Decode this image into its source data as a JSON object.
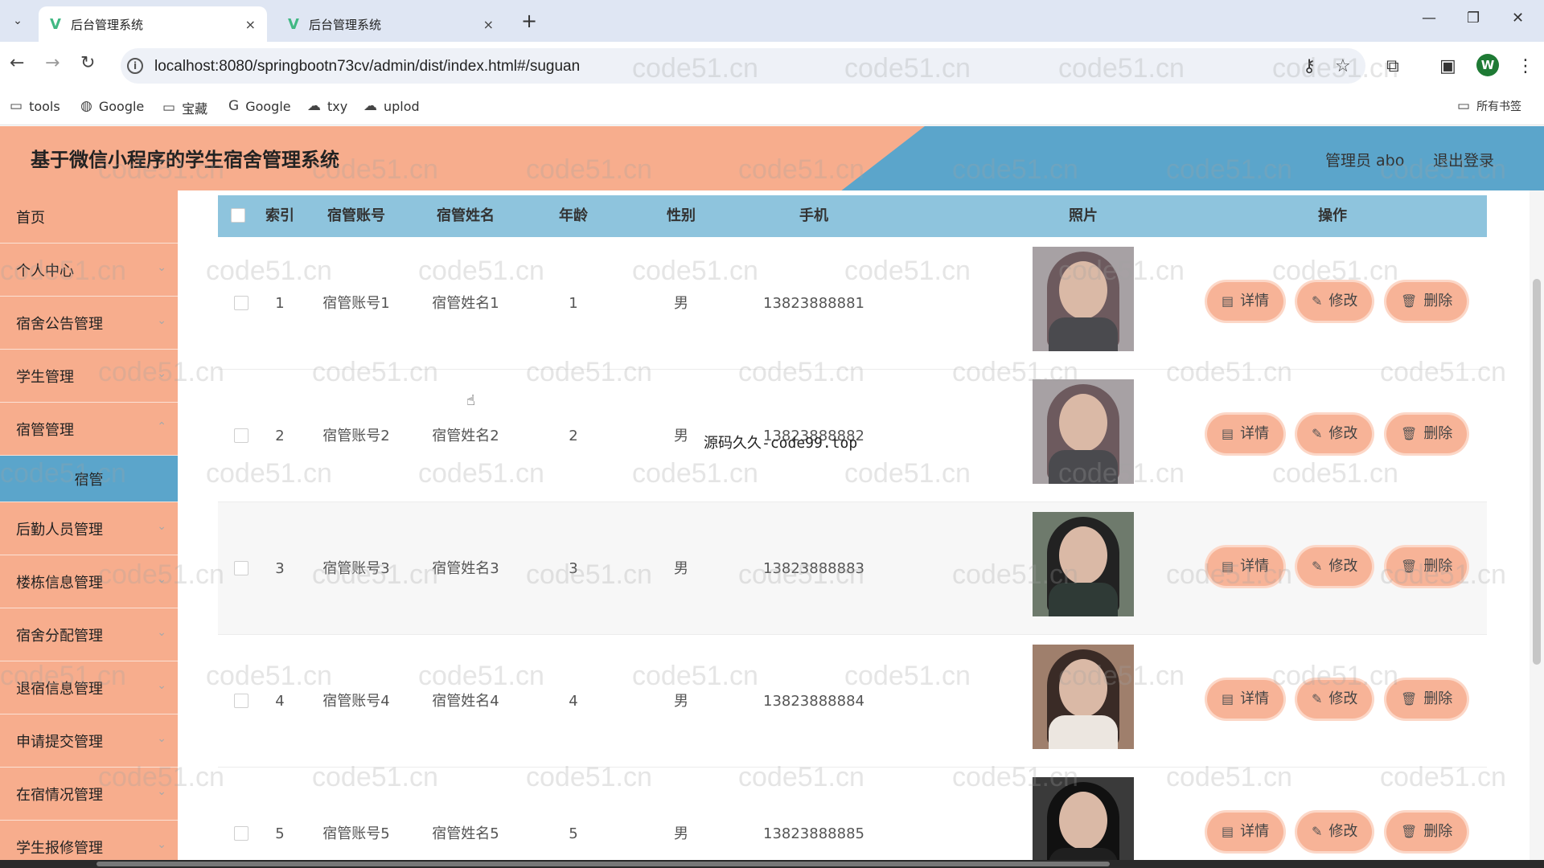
{
  "browser": {
    "tabs": [
      {
        "title": "后台管理系统",
        "close": "×"
      },
      {
        "title": "后台管理系统",
        "close": "×"
      }
    ],
    "new_tab": "+",
    "url": "localhost:8080/springbootn73cv/admin/dist/index.html#/suguan",
    "profile_initial": "W",
    "bookmarks": [
      {
        "icon": "folder-icon",
        "label": "tools"
      },
      {
        "icon": "globe-icon",
        "label": "Google"
      },
      {
        "icon": "folder-icon",
        "label": "宝藏"
      },
      {
        "icon": "google-icon",
        "label": "Google"
      },
      {
        "icon": "cloud-icon",
        "label": "txy"
      },
      {
        "icon": "cloud-upload-icon",
        "label": "uplod"
      }
    ],
    "all_bookmarks": "所有书签"
  },
  "header": {
    "title": "基于微信小程序的学生宿舍管理系统",
    "admin": "管理员 abo",
    "logout": "退出登录"
  },
  "sidebar": {
    "items": [
      {
        "label": "首页",
        "chevron": false
      },
      {
        "label": "个人中心",
        "chevron": true
      },
      {
        "label": "宿舍公告管理",
        "chevron": true
      },
      {
        "label": "学生管理",
        "chevron": true
      },
      {
        "label": "宿管管理",
        "chevron": true
      }
    ],
    "sub_item": "宿管",
    "items_after": [
      {
        "label": "后勤人员管理",
        "chevron": true
      },
      {
        "label": "楼栋信息管理",
        "chevron": true
      },
      {
        "label": "宿舍分配管理",
        "chevron": true
      },
      {
        "label": "退宿信息管理",
        "chevron": true
      },
      {
        "label": "申请提交管理",
        "chevron": true
      },
      {
        "label": "在宿情况管理",
        "chevron": true
      },
      {
        "label": "学生报修管理",
        "chevron": true
      }
    ]
  },
  "table": {
    "headers": [
      "索引",
      "宿管账号",
      "宿管姓名",
      "年龄",
      "性别",
      "手机",
      "照片",
      "操作"
    ],
    "rows": [
      {
        "index": "1",
        "account": "宿管账号1",
        "name": "宿管姓名1",
        "age": "1",
        "gender": "男",
        "phone": "13823888881"
      },
      {
        "index": "2",
        "account": "宿管账号2",
        "name": "宿管姓名2",
        "age": "2",
        "gender": "男",
        "phone": "13823888882"
      },
      {
        "index": "3",
        "account": "宿管账号3",
        "name": "宿管姓名3",
        "age": "3",
        "gender": "男",
        "phone": "13823888883"
      },
      {
        "index": "4",
        "account": "宿管账号4",
        "name": "宿管姓名4",
        "age": "4",
        "gender": "男",
        "phone": "13823888884"
      },
      {
        "index": "5",
        "account": "宿管账号5",
        "name": "宿管姓名5",
        "age": "5",
        "gender": "男",
        "phone": "13823888885"
      }
    ],
    "actions": {
      "detail": "详情",
      "edit": "修改",
      "delete": "删除"
    }
  },
  "overlay_text": "源码久久-code99.top",
  "watermark": "code51.cn",
  "colors": {
    "peach": "#f7ad8d",
    "blue": "#5ba5cb",
    "table_header": "#8ec4dd",
    "button": "#f7b397"
  }
}
